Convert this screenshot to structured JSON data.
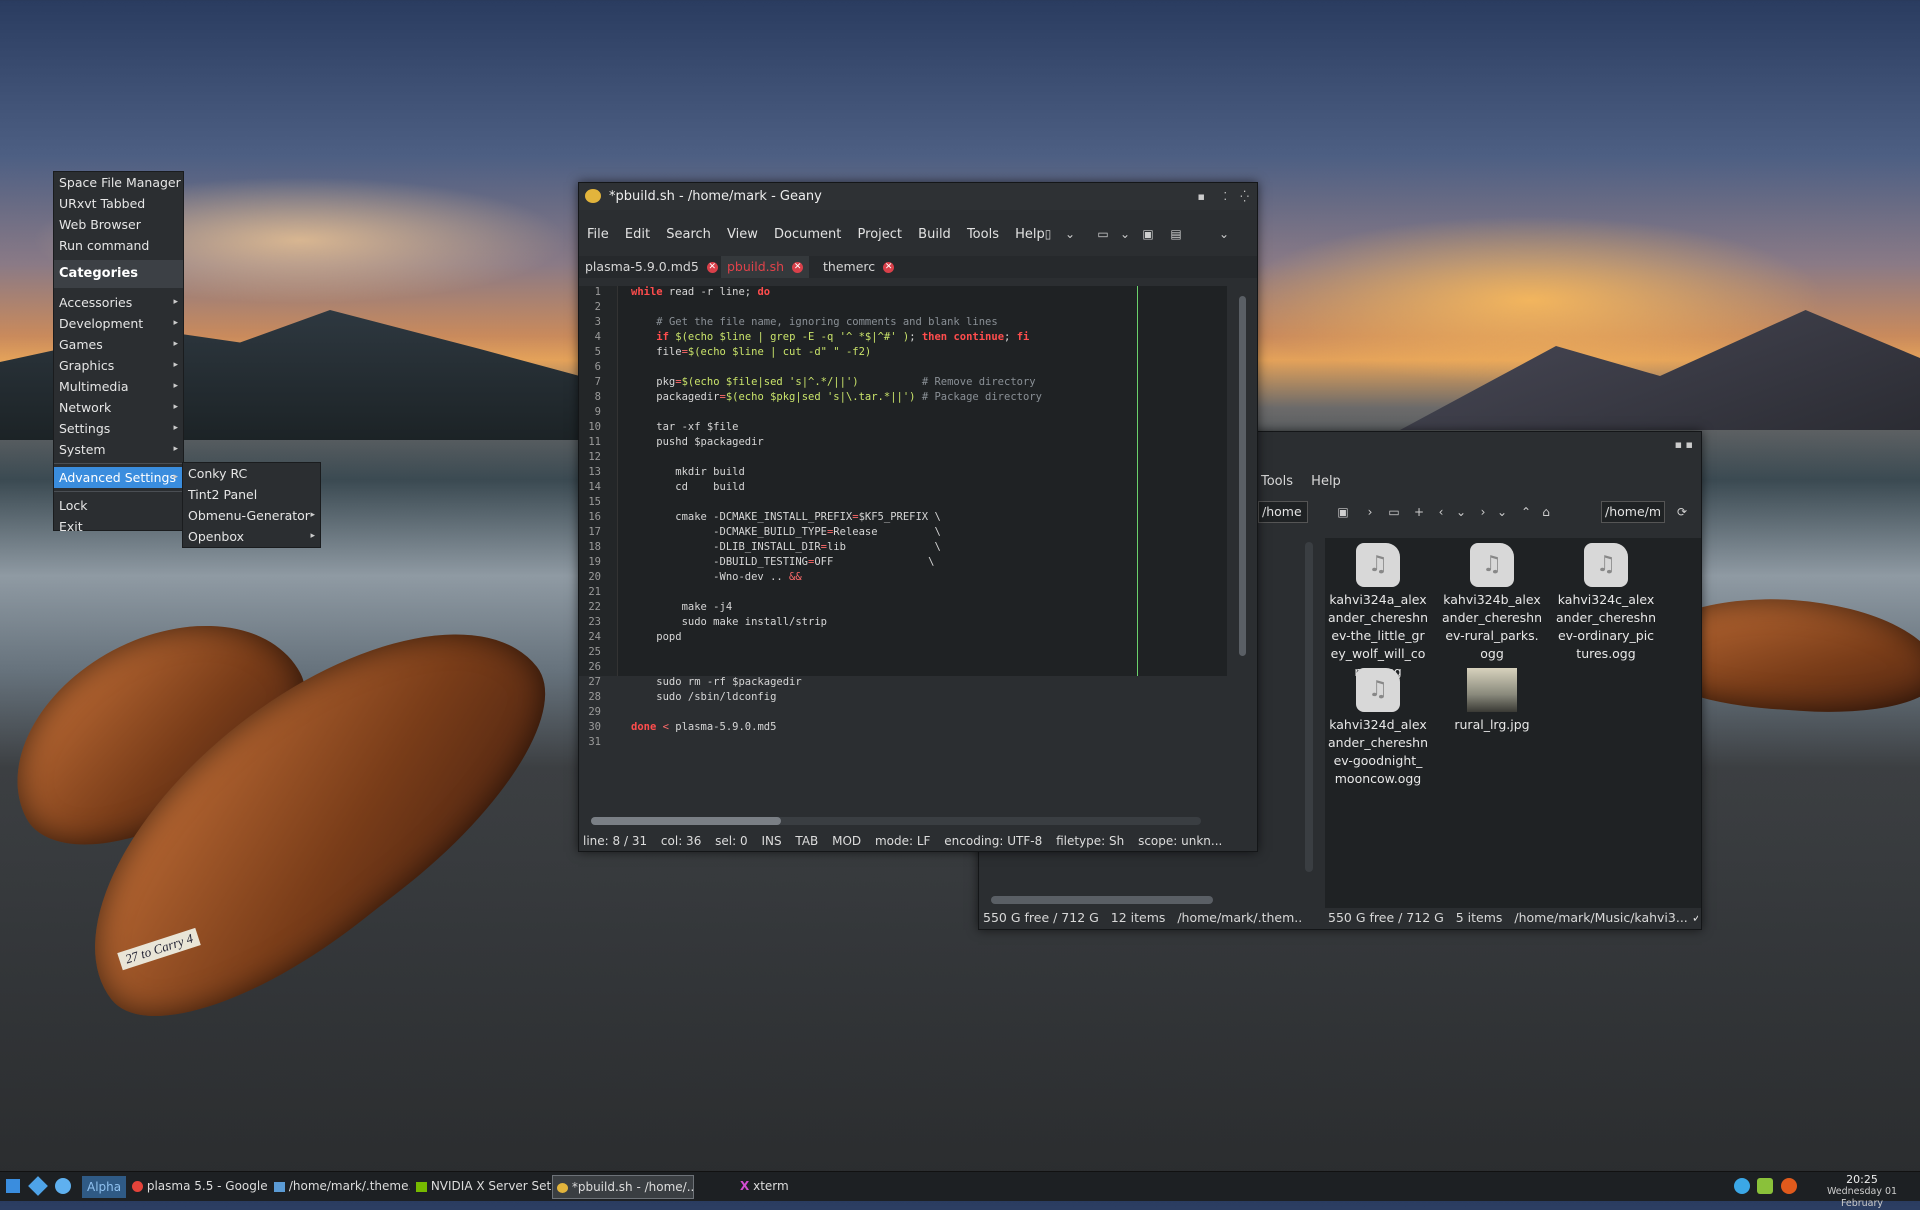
{
  "openbox_menu": {
    "top_items": [
      "Space File Manager",
      "URxvt Tabbed",
      "Web Browser",
      "Run command"
    ],
    "categories_label": "Categories",
    "category_items": [
      "Accessories",
      "Development",
      "Games",
      "Graphics",
      "Multimedia",
      "Network",
      "Settings",
      "System"
    ],
    "advanced_settings": "Advanced Settings",
    "lock": "Lock",
    "exit": "Exit",
    "submenu": [
      "Conky RC",
      "Tint2 Panel",
      "Obmenu-Generator",
      "Openbox"
    ]
  },
  "geany": {
    "title": "*pbuild.sh - /home/mark - Geany",
    "menu": [
      "File",
      "Edit",
      "Search",
      "View",
      "Document",
      "Project",
      "Build",
      "Tools",
      "Help"
    ],
    "tabs": [
      "plasma-5.9.0.md5",
      "pbuild.sh",
      "themerc"
    ],
    "status": {
      "line": "line: 8 / 31",
      "col": "col: 36",
      "sel": "sel: 0",
      "ins": "INS",
      "tab": "TAB",
      "mod": "MOD",
      "mode": "mode: LF",
      "encoding": "encoding: UTF-8",
      "filetype": "filetype: Sh",
      "scope": "scope: unkn..."
    }
  },
  "file_manager": {
    "menu": [
      "Tools",
      "Help"
    ],
    "left_path": "/home",
    "right_path": "/home/m",
    "files": [
      {
        "name": "kahvi324a_alexander_chereshnev-the_little_grey_wolf_will_come.ogg",
        "icon": "audio-file-icon"
      },
      {
        "name": "kahvi324b_alexander_chereshnev-rural_parks.ogg",
        "icon": "audio-file-icon"
      },
      {
        "name": "kahvi324c_alexander_chereshnev-ordinary_pictures.ogg",
        "icon": "audio-file-icon"
      },
      {
        "name": "kahvi324d_alexander_chereshnev-goodnight_mooncow.ogg",
        "icon": "audio-file-icon"
      },
      {
        "name": "rural_lrg.jpg",
        "icon": "image-thumbnail"
      }
    ],
    "status_left": {
      "free": "550 G free / 712 G",
      "items": "12 items",
      "path": "/home/mark/.them..."
    },
    "status_right": {
      "free": "550 G free / 712 G",
      "items": "5 items",
      "path": "/home/mark/Music/kahvi3..."
    }
  },
  "taskbar": {
    "desktop": "Alpha",
    "tasks": [
      "plasma 5.5 - Google...",
      "/home/mark/.theme...",
      "NVIDIA X Server Set...",
      "*pbuild.sh - /home/...",
      "xterm"
    ],
    "time": "20:25",
    "date": "Wednesday 01 February"
  },
  "wallpaper_label": "27 to Carry 4"
}
